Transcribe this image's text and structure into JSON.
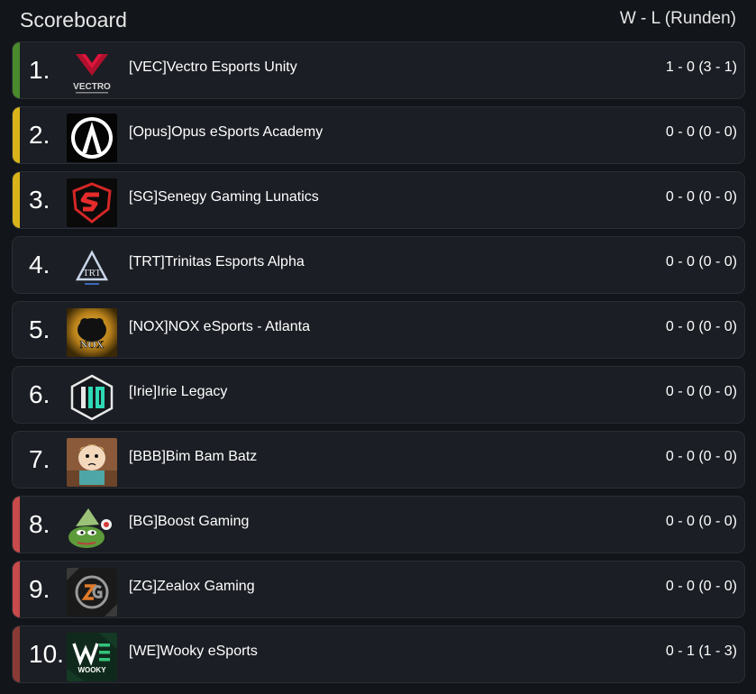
{
  "header": {
    "title": "Scoreboard",
    "columns_label": "W - L (Runden)"
  },
  "colors": {
    "qualified_green": "#4a8a2c",
    "playoff_yellow": "#d8b41a",
    "relegation_red": "#c84a4a",
    "eliminated_darkred": "#8a3a34"
  },
  "rows": [
    {
      "rank": "1.",
      "team": "[VEC]Vectro Esports Unity",
      "score": "1 - 0 (3 - 1)",
      "status": "qualified_green",
      "logo": "vectro-logo",
      "logo_text": "VECTRO"
    },
    {
      "rank": "2.",
      "team": "[Opus]Opus eSports Academy",
      "score": "0 - 0 (0 - 0)",
      "status": "playoff_yellow",
      "logo": "opus-logo"
    },
    {
      "rank": "3.",
      "team": "[SG]Senegy Gaming Lunatics",
      "score": "0 - 0 (0 - 0)",
      "status": "playoff_yellow",
      "logo": "senegy-logo"
    },
    {
      "rank": "4.",
      "team": "[TRT]Trinitas Esports Alpha",
      "score": "0 - 0 (0 - 0)",
      "status": "none",
      "logo": "trinitas-logo",
      "logo_text": "TRT"
    },
    {
      "rank": "5.",
      "team": "[NOX]NOX eSports - Atlanta",
      "score": "0 - 0 (0 - 0)",
      "status": "none",
      "logo": "nox-logo",
      "logo_text": "NOX"
    },
    {
      "rank": "6.",
      "team": "[Irie]Irie Legacy",
      "score": "0 - 0 (0 - 0)",
      "status": "none",
      "logo": "irie-logo"
    },
    {
      "rank": "7.",
      "team": "[BBB]Bim Bam Batz",
      "score": "0 - 0 (0 - 0)",
      "status": "none",
      "logo": "cartoon-character-logo"
    },
    {
      "rank": "8.",
      "team": "[BG]Boost Gaming",
      "score": "0 - 0 (0 - 0)",
      "status": "relegation_red",
      "logo": "frog-logo"
    },
    {
      "rank": "9.",
      "team": "[ZG]Zealox Gaming",
      "score": "0 - 0 (0 - 0)",
      "status": "relegation_red",
      "logo": "zealox-logo"
    },
    {
      "rank": "10.",
      "team": "[WE]Wooky eSports",
      "score": "0 - 1 (1 - 3)",
      "status": "eliminated_darkred",
      "logo": "wooky-logo",
      "logo_text": "WOOKY"
    }
  ]
}
